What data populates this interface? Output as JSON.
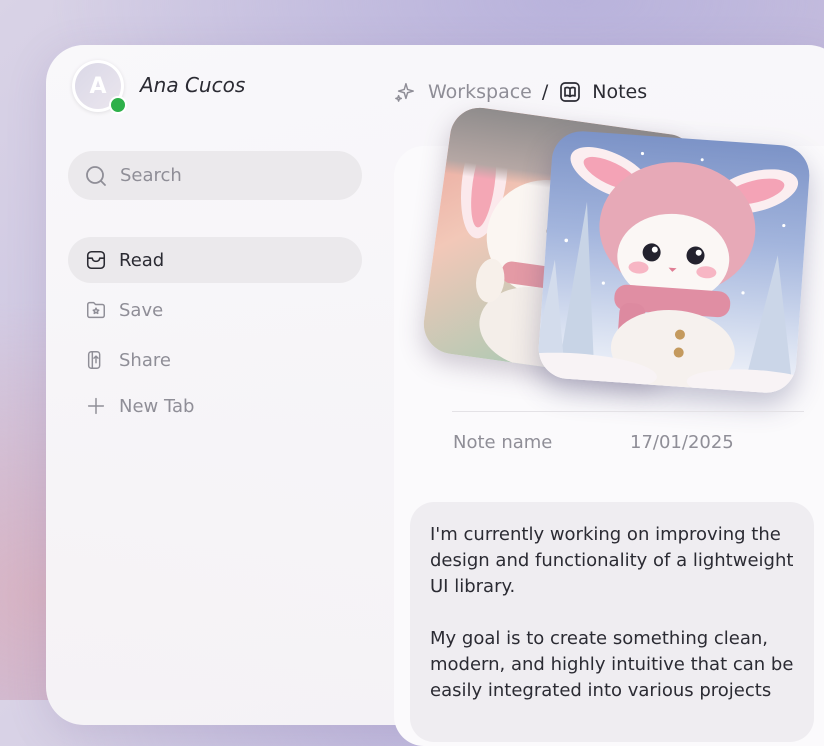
{
  "user": {
    "name": "Ana Cucos",
    "avatar_initial": "A",
    "status": "online",
    "status_color": "#2eb04a"
  },
  "breadcrumb": {
    "workspace": "Workspace",
    "separator": "/",
    "current": "Notes",
    "workspace_icon": "sparkles-icon",
    "current_icon": "book-icon"
  },
  "search": {
    "placeholder": "Search",
    "value": ""
  },
  "nav": {
    "items": [
      {
        "label": "Read",
        "icon": "inbox-icon",
        "active": true
      },
      {
        "label": "Save",
        "icon": "folder-star-icon",
        "active": false
      },
      {
        "label": "Share",
        "icon": "share-icon",
        "active": false
      },
      {
        "label": "New Tab",
        "icon": "plus-icon",
        "active": false
      }
    ]
  },
  "note": {
    "images": [
      "bunny-illustration-back",
      "bunny-illustration-front"
    ],
    "name_label": "Note name",
    "date": "17/01/2025",
    "paragraphs": [
      "I'm currently working on improving the design and functionality of a lightweight UI library.",
      "My goal is to create something clean, modern, and highly intuitive that can be easily integrated into various projects"
    ]
  },
  "colors": {
    "accent_text": "#2b2b33",
    "muted_text": "#8f8e97",
    "active_bg": "#ebe9ec"
  }
}
